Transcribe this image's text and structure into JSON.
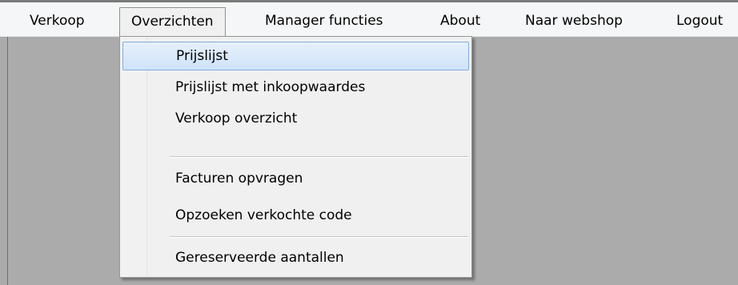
{
  "menubar": {
    "items": [
      {
        "label": "Verkoop"
      },
      {
        "label": "Overzichten",
        "active": true
      },
      {
        "label": "Manager functies"
      },
      {
        "label": "About"
      },
      {
        "label": "Naar webshop"
      },
      {
        "label": "Logout"
      }
    ]
  },
  "dropdown": {
    "items": [
      {
        "label": "Prijslijst",
        "highlighted": true
      },
      {
        "label": "Prijslijst met inkoopwaardes"
      },
      {
        "label": "Verkoop overzicht"
      },
      {
        "label": "Facturen opvragen"
      },
      {
        "label": "Opzoeken verkochte code"
      },
      {
        "label": "Gereserveerde aantallen"
      }
    ]
  },
  "colors": {
    "menubar_bg": "#f5f6f7",
    "client_bg": "#ababab",
    "highlight_border": "#84acdd",
    "highlight_fill": "#cfe3f9"
  }
}
